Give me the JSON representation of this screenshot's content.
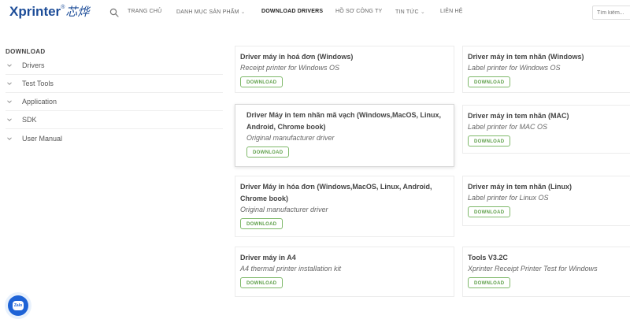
{
  "header": {
    "logo_text": "Xprinter",
    "logo_reg": "®",
    "logo_cn": "芯烨",
    "nav": [
      {
        "label": "TRANG CHỦ",
        "dropdown": false,
        "active": false
      },
      {
        "label": "DANH MỤC SẢN PHẨM",
        "dropdown": true,
        "active": false
      },
      {
        "label": "DOWNLOAD DRIVERS",
        "dropdown": false,
        "active": true
      },
      {
        "label": "HỒ SƠ CÔNG TY",
        "dropdown": false,
        "active": false
      },
      {
        "label": "TIN TỨC",
        "dropdown": true,
        "active": false
      },
      {
        "label": "LIÊN HỆ",
        "dropdown": false,
        "active": false
      }
    ],
    "search_placeholder": "Tìm kiếm..."
  },
  "sidebar": {
    "title": "DOWNLOAD",
    "items": [
      {
        "label": "Drivers"
      },
      {
        "label": "Test Tools"
      },
      {
        "label": "Application"
      },
      {
        "label": "SDK"
      },
      {
        "label": "User Manual"
      }
    ]
  },
  "cards": [
    {
      "title": "Driver máy in hoá đơn (Windows)",
      "subtitle": "Receipt printer for Windows OS",
      "button": "DOWNLOAD"
    },
    {
      "title": "Driver máy in tem nhãn (Windows)",
      "subtitle": "Label printer for Windows OS",
      "button": "DOWNLOAD"
    },
    {
      "title": "Driver Máy in tem nhãn mã vạch (Windows,MacOS, Linux, Android, Chrome book)",
      "subtitle": "Original manufacturer driver",
      "button": "DOWNLOAD"
    },
    {
      "title": "Driver máy in tem nhãn (MAC)",
      "subtitle": "Label printer for MAC OS",
      "button": "DOWNLOAD"
    },
    {
      "title": "Driver Máy in hóa đơn (Windows,MacOS, Linux, Android, Chrome book)",
      "subtitle": "Original manufacturer driver",
      "button": "DOWNLOAD"
    },
    {
      "title": "Driver máy in tem nhãn (Linux)",
      "subtitle": "Label printer for Linux OS",
      "button": "DOWNLOAD"
    },
    {
      "title": "Driver máy in A4",
      "subtitle": "A4 thermal printer installation kit",
      "button": "DOWNLOAD"
    },
    {
      "title": "Tools V3.2C",
      "subtitle": "Xprinter Receipt Printer Test for Windows",
      "button": "DOWNLOAD"
    }
  ],
  "zalo": {
    "label": "Zalo"
  },
  "colors": {
    "brand": "#1c4c98",
    "download_accent": "#5e9f49",
    "zalo": "#1e63d6"
  }
}
